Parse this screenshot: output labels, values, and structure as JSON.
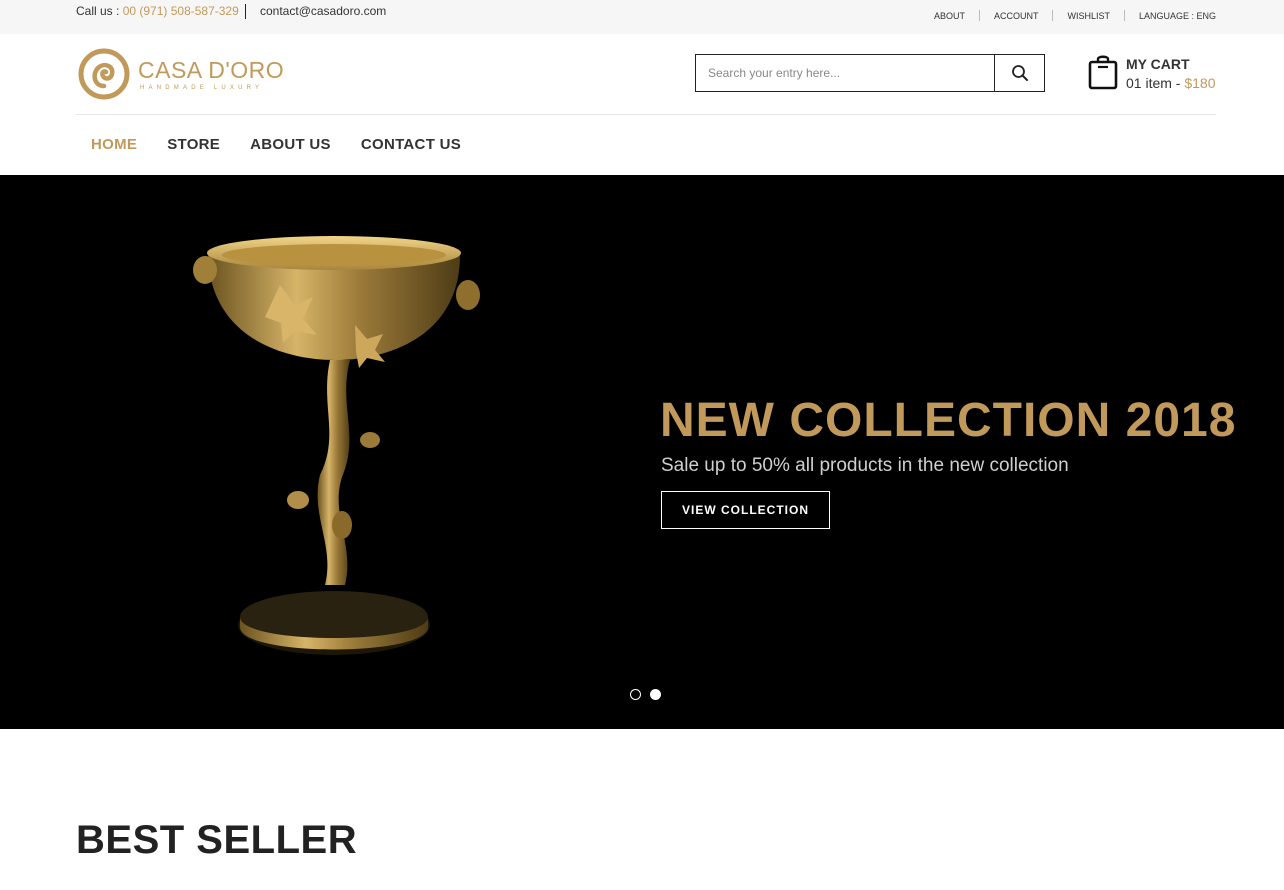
{
  "topbar": {
    "call_label": "Call us : ",
    "phone": "00 (971) 508-587-329",
    "email": "contact@casadoro.com",
    "links": [
      "ABOUT",
      "ACCOUNT",
      "WISHLIST",
      "LANGUAGE : ENG"
    ]
  },
  "brand": {
    "name": "CASA D'ORO",
    "tagline": "HANDMADE LUXURY",
    "color": "#c19a5b"
  },
  "search": {
    "placeholder": "Search your entry here...",
    "icon": "search-icon"
  },
  "cart": {
    "title": "MY CART",
    "items": "01 item - ",
    "total": "$180",
    "icon": "shopping-bag-icon"
  },
  "nav": {
    "items": [
      "HOME",
      "STORE",
      "ABOUT US",
      "CONTACT US"
    ],
    "active": "HOME"
  },
  "hero": {
    "title": "NEW COLLECTION 2018",
    "subtitle": "Sale up to 50% all products in the new collection",
    "button": "VIEW COLLECTION",
    "slides": 2,
    "active_slide": 2
  },
  "sections": {
    "best_seller": "BEST SELLER"
  }
}
